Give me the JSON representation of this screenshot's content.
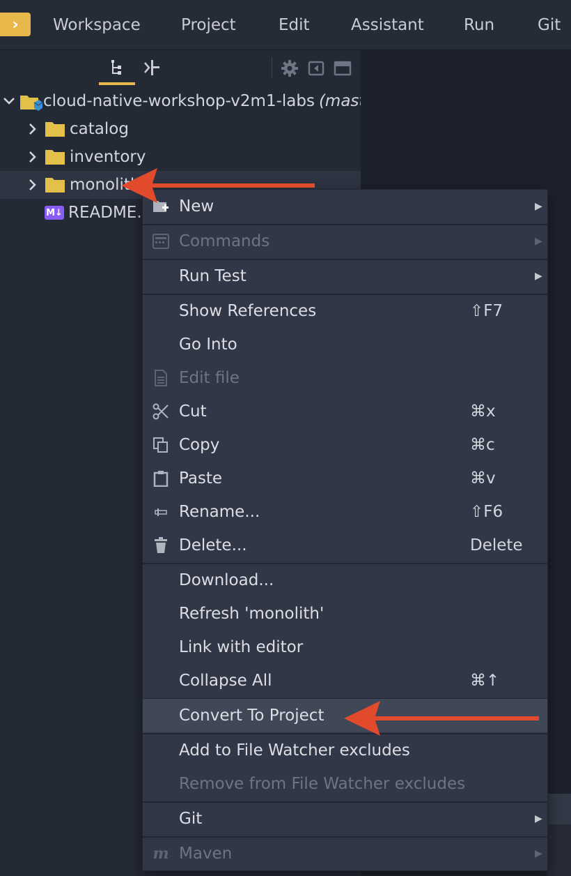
{
  "menubar": {
    "launcher_glyph": "›",
    "items": [
      "Workspace",
      "Project",
      "Edit",
      "Assistant",
      "Run",
      "Git"
    ]
  },
  "panel": {
    "tabs": [
      "project-tree-icon",
      "revision-icon"
    ],
    "tools": [
      "gear-icon",
      "collapse-panel-icon",
      "maximize-panel-icon"
    ]
  },
  "tree": {
    "root": {
      "label": "cloud-native-workshop-v2m1-labs",
      "branch": "(master)"
    },
    "items": [
      {
        "label": "catalog"
      },
      {
        "label": "inventory"
      },
      {
        "label": "monolith"
      },
      {
        "label": "README.md",
        "badge": "M↓"
      }
    ]
  },
  "context_menu": {
    "items": [
      {
        "label": "New",
        "icon": "new-folder-icon",
        "submenu": true,
        "disabled": false
      },
      {
        "label": "Commands",
        "icon": "commands-icon",
        "submenu": true,
        "disabled": true
      },
      {
        "label": "Run Test",
        "submenu": true,
        "disabled": false
      },
      {
        "label": "Show References",
        "shortcut": "⇧F7"
      },
      {
        "label": "Go Into"
      },
      {
        "label": "Edit file",
        "icon": "file-icon",
        "disabled": true
      },
      {
        "label": "Cut",
        "icon": "scissors-icon",
        "shortcut": "⌘x"
      },
      {
        "label": "Copy",
        "icon": "copy-icon",
        "shortcut": "⌘c"
      },
      {
        "label": "Paste",
        "icon": "clipboard-icon",
        "shortcut": "⌘v"
      },
      {
        "label": "Rename...",
        "icon": "rename-icon",
        "shortcut": "⇧F6"
      },
      {
        "label": "Delete...",
        "icon": "trash-icon",
        "shortcut": "Delete"
      },
      {
        "label": "Download..."
      },
      {
        "label": "Refresh 'monolith'"
      },
      {
        "label": "Link with editor"
      },
      {
        "label": "Collapse All",
        "shortcut": "⌘↑"
      },
      {
        "label": "Convert To Project",
        "highlighted": true
      },
      {
        "label": "Add to File Watcher excludes"
      },
      {
        "label": "Remove from File Watcher excludes",
        "disabled": true
      },
      {
        "label": "Git",
        "submenu": true
      },
      {
        "label": "Maven",
        "icon": "maven-icon",
        "icon_glyph": "m",
        "submenu": true,
        "disabled": true
      }
    ],
    "submenu_arrow": "▶"
  },
  "colors": {
    "accent": "#e8b94a",
    "folder": "#e2c049",
    "annotation_arrow": "#e24a2c",
    "markdown_badge": "#8a5cf6"
  }
}
